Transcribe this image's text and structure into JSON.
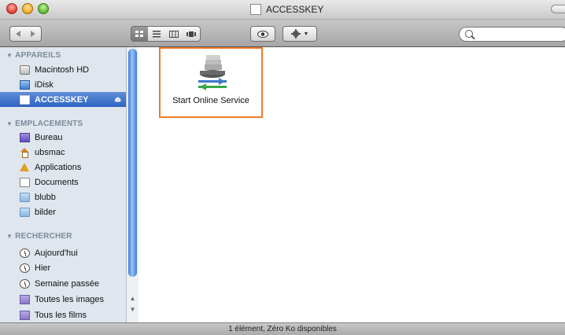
{
  "window": {
    "title": "ACCESSKEY"
  },
  "sidebar": {
    "sections": [
      {
        "heading": "APPAREILS",
        "items": [
          {
            "label": "Macintosh HD",
            "icon": "hard-disk-icon"
          },
          {
            "label": "iDisk",
            "icon": "idisk-icon"
          },
          {
            "label": "ACCESSKEY",
            "icon": "usb-drive-icon",
            "selected": true
          }
        ]
      },
      {
        "heading": "EMPLACEMENTS",
        "items": [
          {
            "label": "Bureau",
            "icon": "desktop-icon"
          },
          {
            "label": "ubsmac",
            "icon": "home-icon"
          },
          {
            "label": "Applications",
            "icon": "applications-icon"
          },
          {
            "label": "Documents",
            "icon": "documents-icon"
          },
          {
            "label": "blubb",
            "icon": "folder-icon"
          },
          {
            "label": "bilder",
            "icon": "folder-icon"
          }
        ]
      },
      {
        "heading": "RECHERCHER",
        "items": [
          {
            "label": "Aujourd'hui",
            "icon": "clock-icon"
          },
          {
            "label": "Hier",
            "icon": "clock-icon"
          },
          {
            "label": "Semaine passée",
            "icon": "clock-icon"
          },
          {
            "label": "Toutes les images",
            "icon": "smart-folder-icon"
          },
          {
            "label": "Tous les films",
            "icon": "smart-folder-icon"
          }
        ]
      }
    ]
  },
  "main": {
    "items": [
      {
        "label": "Start Online Service",
        "icon": "online-service-icon",
        "highlight_color": "#f07a2a"
      }
    ]
  },
  "status": {
    "text": "1 élément, Zéro Ko disponibles"
  },
  "colors": {
    "selection": "#2e63c2",
    "sidebar_bg": "#dfe6ee",
    "highlight": "#f07a2a"
  }
}
